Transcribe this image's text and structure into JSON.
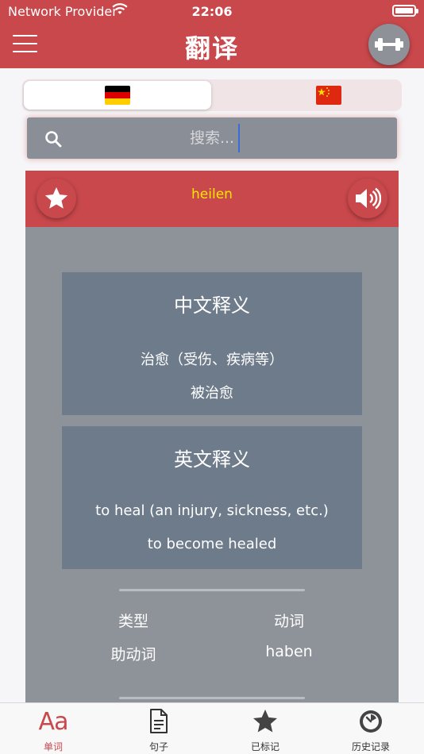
{
  "status": {
    "carrier": "Network Provider",
    "time": "22:06"
  },
  "nav": {
    "title": "翻译",
    "menu_icon": "hamburger-icon",
    "action_icon": "dumbbell-icon"
  },
  "languages": {
    "options": [
      {
        "name": "german-flag",
        "selected": true
      },
      {
        "name": "chinese-flag",
        "selected": false
      }
    ]
  },
  "search": {
    "placeholder": "搜索..."
  },
  "word_card": {
    "word": "heilen",
    "chinese": {
      "title": "中文释义",
      "lines": [
        "治愈（受伤、疾病等）",
        "被治愈"
      ]
    },
    "english": {
      "title": "英文释义",
      "lines": [
        "to heal (an injury, sickness, etc.)",
        "to become healed"
      ]
    },
    "meta": {
      "type_label": "类型",
      "type_value": "动词",
      "aux_label": "助动词",
      "aux_value": "haben"
    }
  },
  "tabs": [
    {
      "label": "单词",
      "icon": "Aa",
      "active": true
    },
    {
      "label": "句子",
      "icon": "document-icon",
      "active": false
    },
    {
      "label": "已标记",
      "icon": "star-icon",
      "active": false
    },
    {
      "label": "历史记录",
      "icon": "history-icon",
      "active": false
    }
  ],
  "colors": {
    "accent": "#c9484c",
    "card": "#8e9299",
    "panel": "#6e7b8b",
    "word": "#ffe600"
  }
}
